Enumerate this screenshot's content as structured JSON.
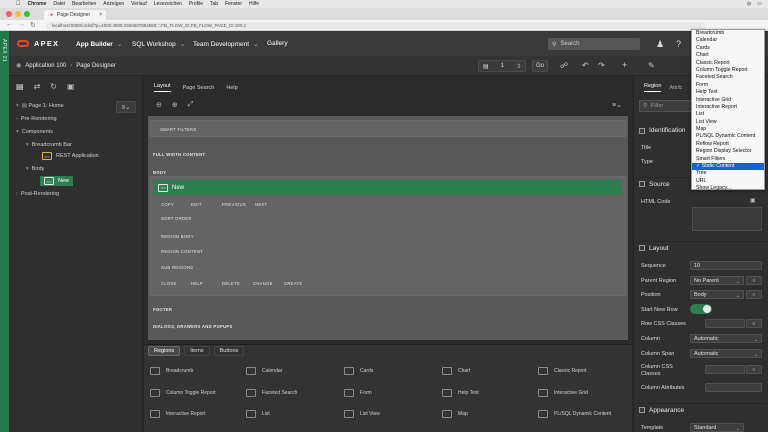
{
  "macos": {
    "app": "Chrome",
    "menus": [
      "Datei",
      "Bearbeiten",
      "Anzeigen",
      "Verlauf",
      "Lesezeichen",
      "Profile",
      "Tab",
      "Fenster",
      "Hilfe"
    ]
  },
  "browser": {
    "tab_title": "Page Designer",
    "url": "localhost:8080/ords/f?p=4000:4500:4366507894860::::FB_FLOW_ID,FB_FLOW_PAGE_ID:100,1"
  },
  "apex": {
    "side_label": "APEX 21",
    "logo_text": "APEX",
    "nav": {
      "app_builder": "App Builder",
      "sql_workshop": "SQL Workshop",
      "team_development": "Team Development",
      "gallery": "Gallery"
    },
    "search_placeholder": "Search"
  },
  "toolbar": {
    "app": "Application 100",
    "page_designer": "Page Designer",
    "page_number": "1",
    "go": "Go"
  },
  "left_tree": {
    "page": "Page 1: Home",
    "pre_rendering": "Pre-Rendering",
    "components": "Components",
    "breadcrumb_bar": "Breadcrumb Bar",
    "rest_application": "REST Application",
    "body": "Body",
    "new_region": "New",
    "post_rendering": "Post-Rendering"
  },
  "mid_tabs": {
    "layout": "Layout",
    "page_search": "Page Search",
    "help": "Help"
  },
  "canvas": {
    "smart_filters": "SMART FILTERS",
    "full_width_content": "FULL WIDTH CONTENT",
    "body": "BODY",
    "new_region": "New",
    "row1": [
      "COPY",
      "EDIT",
      "PREVIOUS",
      "NEXT"
    ],
    "sort_order": "SORT ORDER",
    "region_body": "REGION BODY",
    "region_content": "REGION CONTENT",
    "sub_regions": "SUB REGIONS",
    "row2": [
      "CLOSE",
      "HELP",
      "DELETE",
      "CHANGE",
      "CREATE"
    ],
    "footer": "FOOTER",
    "dialogs": "DIALOGS, DRAWERS AND POPUPS"
  },
  "gallery": {
    "tabs": {
      "regions": "Regions",
      "items": "Items",
      "buttons": "Buttons"
    },
    "items": [
      "Breadcrumb",
      "Calendar",
      "Cards",
      "Chart",
      "Classic Report",
      "Column Toggle Report",
      "Faceted Search",
      "Form",
      "Help Text",
      "Interactive Grid",
      "Interactive Report",
      "List",
      "List View",
      "Map",
      "PL/SQL Dynamic Content"
    ]
  },
  "right": {
    "tab_region": "Region",
    "tab_attributes": "Attrib",
    "filter_placeholder": "Filter",
    "identification": "Identification",
    "title_label": "Title",
    "type_label": "Type",
    "source": "Source",
    "html_code": "HTML Code",
    "layout": "Layout",
    "sequence_label": "Sequence",
    "sequence_value": "10",
    "parent_region_label": "Parent Region",
    "parent_region_value": "No Parent",
    "position_label": "Position",
    "position_value": "Body",
    "start_new_row_label": "Start New Row",
    "row_css_label": "Row CSS Classes",
    "column_label": "Column",
    "column_value": "Automatic",
    "column_span_label": "Column Span",
    "column_span_value": "Automatic",
    "column_css_label": "Column CSS Classes",
    "column_attr_label": "Column Attributes",
    "appearance": "Appearance",
    "template_label": "Template",
    "template_value": "Standard"
  },
  "dropdown": {
    "options": [
      "Breadcrumb",
      "Calendar",
      "Cards",
      "Chart",
      "Classic Report",
      "Column Toggle Report",
      "Faceted Search",
      "Form",
      "Help Text",
      "Interactive Grid",
      "Interactive Report",
      "List",
      "List View",
      "Map",
      "PL/SQL Dynamic Content",
      "Reflow Report",
      "Region Display Selector",
      "Smart Filters",
      "Static Content",
      "Tree",
      "URL",
      "Show Legacy..."
    ],
    "selected": "Static Content"
  },
  "colors": {
    "accent_green": "#2f7d52",
    "apex_red": "#e04a2b",
    "selection_blue": "#1c5fd8"
  }
}
